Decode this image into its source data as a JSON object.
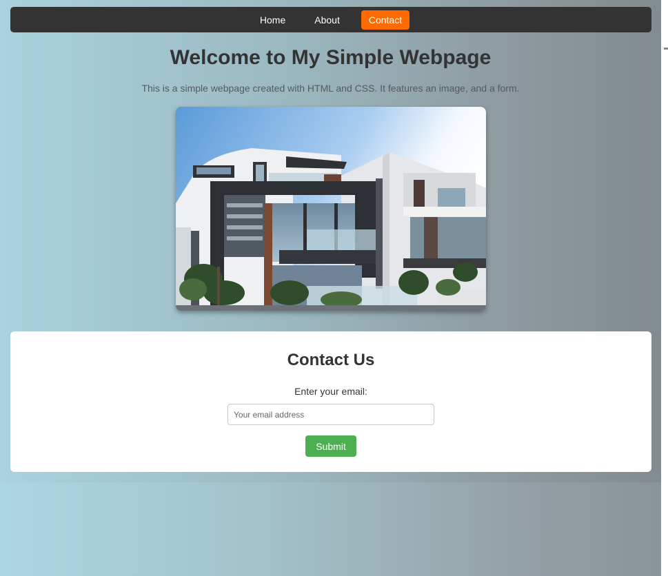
{
  "nav": {
    "items": [
      {
        "label": "Home"
      },
      {
        "label": "About"
      },
      {
        "label": "Contact",
        "active": true
      }
    ],
    "active_color": "#ff6a00"
  },
  "header": {
    "title": "Welcome to My Simple Webpage",
    "intro": "This is a simple webpage created with HTML and CSS. It features an image, and a form."
  },
  "hero": {
    "image": "modern-house-photo"
  },
  "contact": {
    "title": "Contact Us",
    "email_label": "Enter your email:",
    "email_placeholder": "Your email address",
    "email_value": "",
    "submit_label": "Submit",
    "submit_color": "#4caf50"
  }
}
